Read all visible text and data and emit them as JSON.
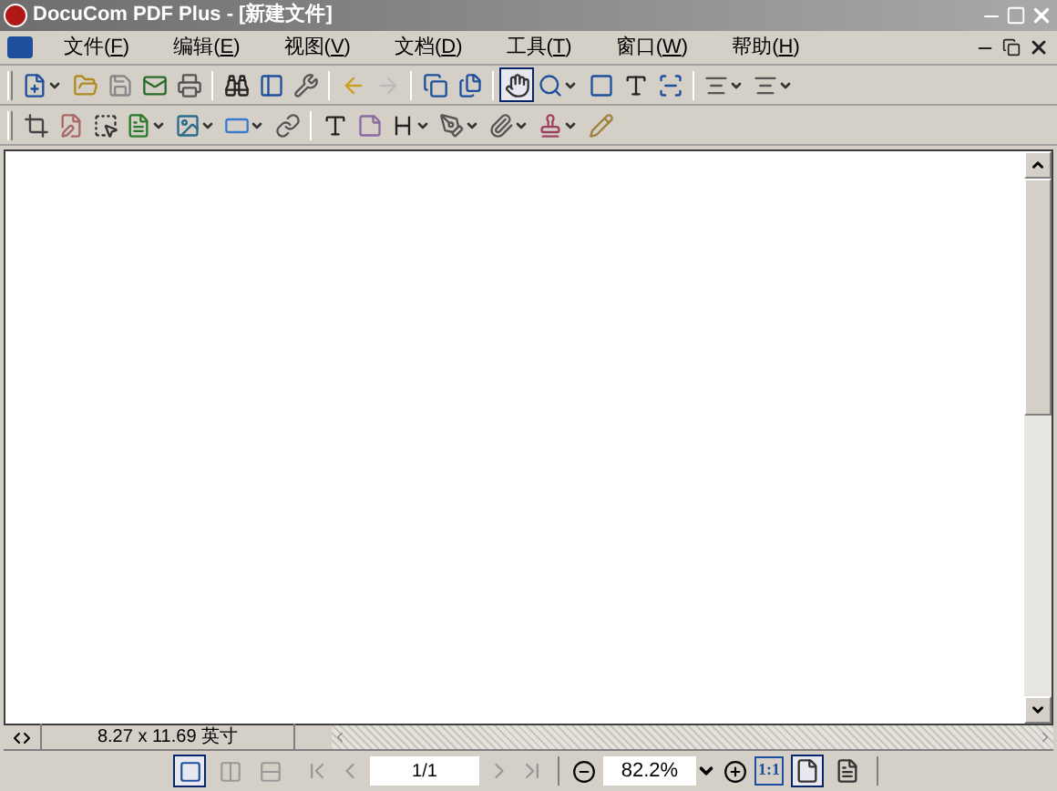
{
  "window": {
    "title": "DocuCom PDF Plus - [新建文件]"
  },
  "menu": [
    {
      "label": "文件(F)"
    },
    {
      "label": "编辑(E)"
    },
    {
      "label": "视图(V)"
    },
    {
      "label": "文档(D)"
    },
    {
      "label": "工具(T)"
    },
    {
      "label": "窗口(W)"
    },
    {
      "label": "帮助(H)"
    }
  ],
  "toolbar_1": [
    {
      "kind": "new",
      "dropdown": true,
      "selected": false
    },
    {
      "kind": "open",
      "dropdown": false,
      "selected": false
    },
    {
      "kind": "save",
      "dropdown": false,
      "selected": false
    },
    {
      "kind": "mail",
      "dropdown": false,
      "selected": false
    },
    {
      "kind": "print",
      "dropdown": false,
      "selected": false
    },
    {
      "kind": "separator"
    },
    {
      "kind": "find",
      "dropdown": false,
      "selected": false
    },
    {
      "kind": "panel",
      "dropdown": false,
      "selected": false
    },
    {
      "kind": "tools",
      "dropdown": false,
      "selected": false
    },
    {
      "kind": "separator"
    },
    {
      "kind": "back",
      "dropdown": false,
      "selected": false
    },
    {
      "kind": "forward",
      "dropdown": false,
      "selected": false
    },
    {
      "kind": "separator"
    },
    {
      "kind": "extract",
      "dropdown": false,
      "selected": false
    },
    {
      "kind": "insert",
      "dropdown": false,
      "selected": false
    },
    {
      "kind": "separator"
    },
    {
      "kind": "hand",
      "dropdown": false,
      "selected": true
    },
    {
      "kind": "zoom",
      "dropdown": true,
      "selected": false
    },
    {
      "kind": "snapshot",
      "dropdown": false,
      "selected": false
    },
    {
      "kind": "textselect",
      "dropdown": false,
      "selected": false
    },
    {
      "kind": "imageselect",
      "dropdown": false,
      "selected": false
    },
    {
      "kind": "separator"
    },
    {
      "kind": "align",
      "dropdown": true,
      "selected": false
    },
    {
      "kind": "align",
      "dropdown": true,
      "selected": false
    }
  ],
  "toolbar_2": [
    {
      "kind": "crop",
      "dropdown": false,
      "selected": false
    },
    {
      "kind": "edittext",
      "dropdown": false,
      "selected": false
    },
    {
      "kind": "selectarea",
      "dropdown": false,
      "selected": false
    },
    {
      "kind": "word",
      "dropdown": true,
      "selected": false
    },
    {
      "kind": "image",
      "dropdown": true,
      "selected": false
    },
    {
      "kind": "field",
      "dropdown": true,
      "selected": false
    },
    {
      "kind": "link",
      "dropdown": false,
      "selected": false
    },
    {
      "kind": "separator"
    },
    {
      "kind": "textbox",
      "dropdown": false,
      "selected": false
    },
    {
      "kind": "note",
      "dropdown": false,
      "selected": false
    },
    {
      "kind": "heading",
      "dropdown": true,
      "selected": false
    },
    {
      "kind": "pen",
      "dropdown": true,
      "selected": false
    },
    {
      "kind": "attach",
      "dropdown": true,
      "selected": false
    },
    {
      "kind": "stamp",
      "dropdown": true,
      "selected": false
    },
    {
      "kind": "pencil",
      "dropdown": false,
      "selected": false
    }
  ],
  "page_size": "8.27 x 11.69 英寸",
  "status_bar": {
    "page_field": "1/1",
    "zoom_field": "82.2%",
    "actual_size_label": "1:1",
    "view_modes": [
      {
        "kind": "single",
        "selected": true
      },
      {
        "kind": "facing",
        "selected": false
      },
      {
        "kind": "continuous",
        "selected": false
      }
    ],
    "fit_modes": [
      {
        "kind": "fitpage",
        "selected": true
      },
      {
        "kind": "fitwidth",
        "selected": false
      }
    ]
  }
}
